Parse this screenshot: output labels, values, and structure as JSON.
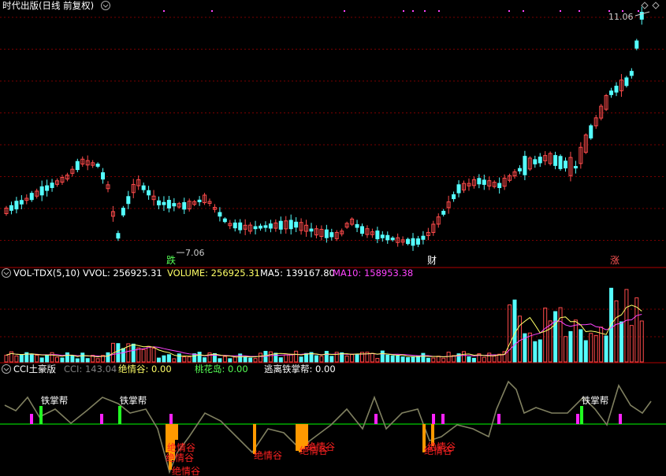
{
  "main_header": {
    "title": "时代出版(日线 前复权)"
  },
  "annotations": {
    "high_price": "11.06",
    "low_price": "7.06"
  },
  "markers": [
    {
      "label": "跌",
      "color": "#55ff55"
    },
    {
      "label": "财",
      "color": "#ffffff"
    },
    {
      "label": "涨",
      "color": "#ff5555"
    }
  ],
  "volume_header": {
    "name": "VOL-TDX(5,10)",
    "vvol": "VVOL: 256925.31",
    "volume": "VOLUME: 256925.31",
    "ma5": "MA5: 139167.80",
    "ma10": "MA10: 158953.38"
  },
  "cci_header": {
    "name": "CCI土豪版",
    "cci": "CCI: 143.04",
    "juegu": "绝情谷: 0.00",
    "taohua": "桃花岛: 0.00",
    "taoli": "逃离铁掌帮: 0.00"
  },
  "cci_labels": {
    "tiezhang": "铁掌帮",
    "juegu": "绝情谷"
  },
  "colors": {
    "up": "#ff4b4b",
    "down": "#55ffff",
    "ma5": "#ffff66",
    "ma10": "#ff44ff",
    "cci": "#808060",
    "zero": "#00cc00",
    "orange": "#ff9900"
  },
  "icons": {
    "collapse": "chevron-down-icon",
    "window": "diamond-icon"
  }
}
